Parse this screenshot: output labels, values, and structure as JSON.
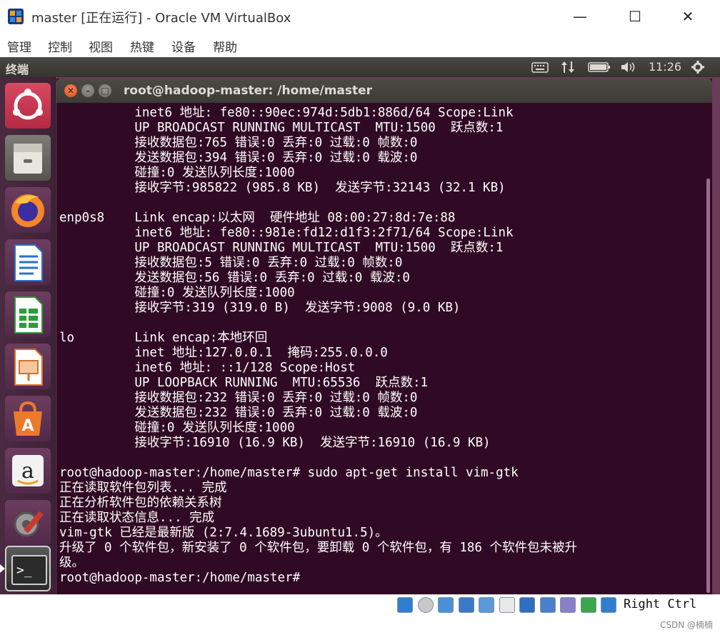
{
  "host_window": {
    "title": "master [正在运行] - Oracle VM VirtualBox",
    "menu": [
      "管理",
      "控制",
      "视图",
      "热键",
      "设备",
      "帮助"
    ],
    "min_symbol": "—",
    "max_symbol": "☐",
    "close_symbol": "✕"
  },
  "ubuntu_panel": {
    "app_name": "终端",
    "time": "11:26",
    "icons": [
      "keyboard-icon",
      "network-icon",
      "battery-icon",
      "volume-icon",
      "settings-gear-icon"
    ]
  },
  "launcher": {
    "items": [
      {
        "name": "ubuntu-dash-icon",
        "color": "#c4354f"
      },
      {
        "name": "files-icon",
        "color": "#6b6a64"
      },
      {
        "name": "firefox-icon",
        "color": "#e55b24"
      },
      {
        "name": "libreoffice-writer-icon",
        "color": "#2a72c6"
      },
      {
        "name": "libreoffice-calc-icon",
        "color": "#2d9b3a"
      },
      {
        "name": "libreoffice-impress-icon",
        "color": "#d86f29"
      },
      {
        "name": "software-center-icon",
        "color": "#e0671f"
      },
      {
        "name": "amazon-icon",
        "color": "#e8e8e8"
      },
      {
        "name": "system-settings-icon",
        "color": "#8a8a8a"
      },
      {
        "name": "terminal-icon",
        "color": "#2b2b2b"
      }
    ]
  },
  "terminal": {
    "title": "root@hadoop-master: /home/master",
    "lines": [
      "          inet6 地址: fe80::90ec:974d:5db1:886d/64 Scope:Link",
      "          UP BROADCAST RUNNING MULTICAST  MTU:1500  跃点数:1",
      "          接收数据包:765 错误:0 丢弃:0 过载:0 帧数:0",
      "          发送数据包:394 错误:0 丢弃:0 过载:0 载波:0",
      "          碰撞:0 发送队列长度:1000",
      "          接收字节:985822 (985.8 KB)  发送字节:32143 (32.1 KB)",
      "",
      "enp0s8    Link encap:以太网  硬件地址 08:00:27:8d:7e:88",
      "          inet6 地址: fe80::981e:fd12:d1f3:2f71/64 Scope:Link",
      "          UP BROADCAST RUNNING MULTICAST  MTU:1500  跃点数:1",
      "          接收数据包:5 错误:0 丢弃:0 过载:0 帧数:0",
      "          发送数据包:56 错误:0 丢弃:0 过载:0 载波:0",
      "          碰撞:0 发送队列长度:1000",
      "          接收字节:319 (319.0 B)  发送字节:9008 (9.0 KB)",
      "",
      "lo        Link encap:本地环回",
      "          inet 地址:127.0.0.1  掩码:255.0.0.0",
      "          inet6 地址: ::1/128 Scope:Host",
      "          UP LOOPBACK RUNNING  MTU:65536  跃点数:1",
      "          接收数据包:232 错误:0 丢弃:0 过载:0 帧数:0",
      "          发送数据包:232 错误:0 丢弃:0 过载:0 载波:0",
      "          碰撞:0 发送队列长度:1000",
      "          接收字节:16910 (16.9 KB)  发送字节:16910 (16.9 KB)",
      "",
      "root@hadoop-master:/home/master# sudo apt-get install vim-gtk",
      "正在读取软件包列表... 完成",
      "正在分析软件包的依赖关系树",
      "正在读取状态信息... 完成",
      "vim-gtk 已经是最新版 (2:7.4.1689-3ubuntu1.5)。",
      "升级了 0 个软件包，新安装了 0 个软件包，要卸载 0 个软件包，有 186 个软件包未被升",
      "级。",
      "root@hadoop-master:/home/master# "
    ]
  },
  "vbox_status": {
    "host_key": "Right Ctrl",
    "icons": [
      "hard-disk-icon",
      "optical-disk-icon",
      "audio-icon",
      "network-adapter-icon",
      "usb-icon",
      "shared-folder-icon",
      "display-icon",
      "video-capture-icon",
      "cpu-icon",
      "mouse-integration-icon",
      "keyboard-capture-icon"
    ]
  },
  "watermark": "CSDN @楠楠"
}
